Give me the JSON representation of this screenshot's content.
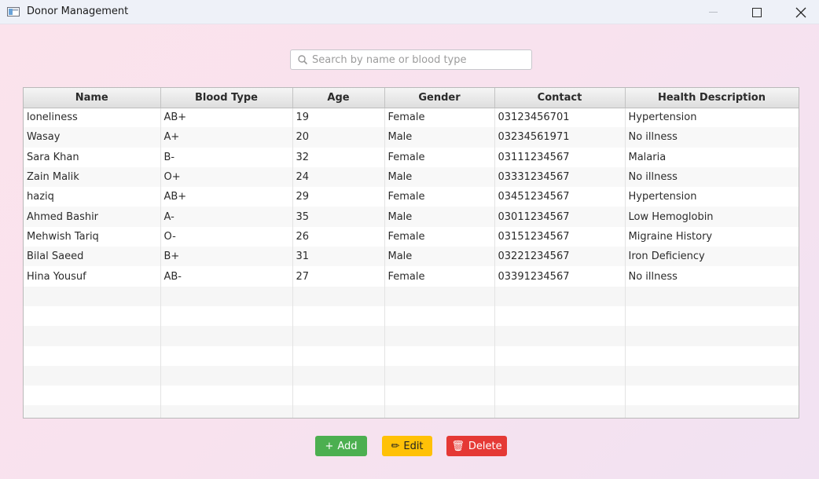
{
  "window": {
    "title": "Donor Management",
    "minimize_icon": "minimize-icon",
    "maximize_icon": "maximize-icon",
    "close_icon": "close-icon"
  },
  "search": {
    "placeholder": "Search by name or blood type",
    "value": "",
    "icon": "search-icon"
  },
  "table": {
    "columns": [
      "Name",
      "Blood Type",
      "Age",
      "Gender",
      "Contact",
      "Health Description"
    ],
    "rows": [
      [
        "loneliness",
        "AB+",
        "19",
        "Female",
        "03123456701",
        "Hypertension"
      ],
      [
        "Wasay",
        "A+",
        "20",
        "Male",
        "03234561971",
        "No illness"
      ],
      [
        "Sara Khan",
        "B-",
        "32",
        "Female",
        "03111234567",
        "Malaria"
      ],
      [
        "Zain Malik",
        "O+",
        "24",
        "Male",
        "03331234567",
        "No illness"
      ],
      [
        "haziq",
        "AB+",
        "29",
        "Female",
        "03451234567",
        "Hypertension"
      ],
      [
        "Ahmed Bashir",
        "A-",
        "35",
        "Male",
        "03011234567",
        "Low Hemoglobin"
      ],
      [
        "Mehwish Tariq",
        "O-",
        "26",
        "Female",
        "03151234567",
        "Migraine History"
      ],
      [
        "Bilal Saeed",
        "B+",
        "31",
        "Male",
        "03221234567",
        "Iron Deficiency"
      ],
      [
        "Hina Yousuf",
        "AB-",
        "27",
        "Female",
        "03391234567",
        "No illness"
      ]
    ]
  },
  "buttons": {
    "add": {
      "label": "Add",
      "icon": "plus-icon",
      "glyph": "+",
      "color": "#4caf50"
    },
    "edit": {
      "label": "Edit",
      "icon": "pencil-icon",
      "glyph": "✏",
      "color": "#ffc107"
    },
    "delete": {
      "label": "Delete",
      "icon": "trash-icon",
      "glyph": "🗑",
      "color": "#e53935"
    }
  }
}
